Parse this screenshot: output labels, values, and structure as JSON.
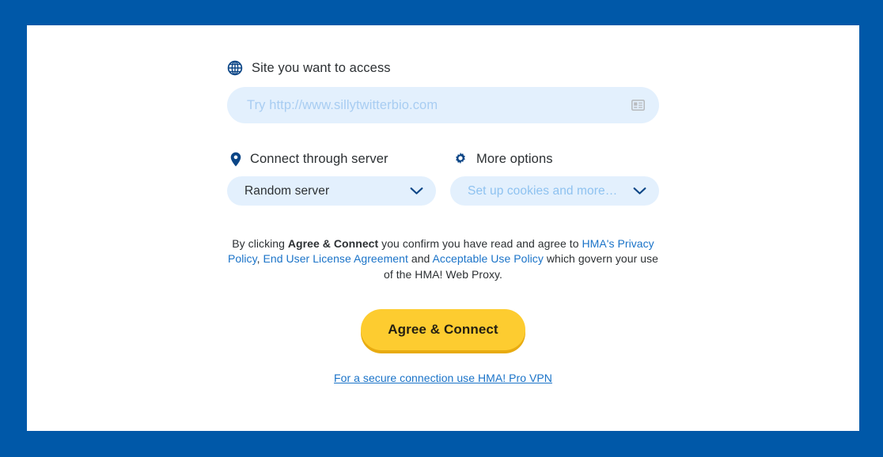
{
  "theme": {
    "page_background": "#0058a8",
    "card_background": "#ffffff",
    "field_background": "#e3f0fd",
    "accent_navy": "#0b4586",
    "link_blue": "#1a73c8",
    "placeholder_blue": "#a8cdf2",
    "cta_yellow": "#fdcc30",
    "cta_shadow": "#e8ab10",
    "text_dark": "#2c3033"
  },
  "site_field": {
    "label": "Site you want to access",
    "icon": "globe-icon",
    "placeholder": "Try http://www.sillytwitterbio.com",
    "value": "",
    "trailing_icon": "autofill-card-icon"
  },
  "server_field": {
    "label": "Connect through server",
    "icon": "location-pin-icon",
    "selected": "Random server",
    "chevron": "chevron-down-icon"
  },
  "options_field": {
    "label": "More options",
    "icon": "gear-icon",
    "selected": "Set up cookies and more…",
    "is_placeholder": true,
    "chevron": "chevron-down-icon"
  },
  "legal": {
    "part1": "By clicking ",
    "bold": "Agree & Connect",
    "part2": " you confirm you have read and agree to ",
    "link1": "HMA's Privacy Policy",
    "sep1": ", ",
    "link2": "End User License Agreement",
    "sep2": " and ",
    "link3": "Acceptable Use Policy",
    "part3": " which govern your use of the HMA! Web Proxy."
  },
  "cta": {
    "label": "Agree & Connect"
  },
  "footer": {
    "link_label": "For a secure connection use HMA! Pro VPN"
  }
}
